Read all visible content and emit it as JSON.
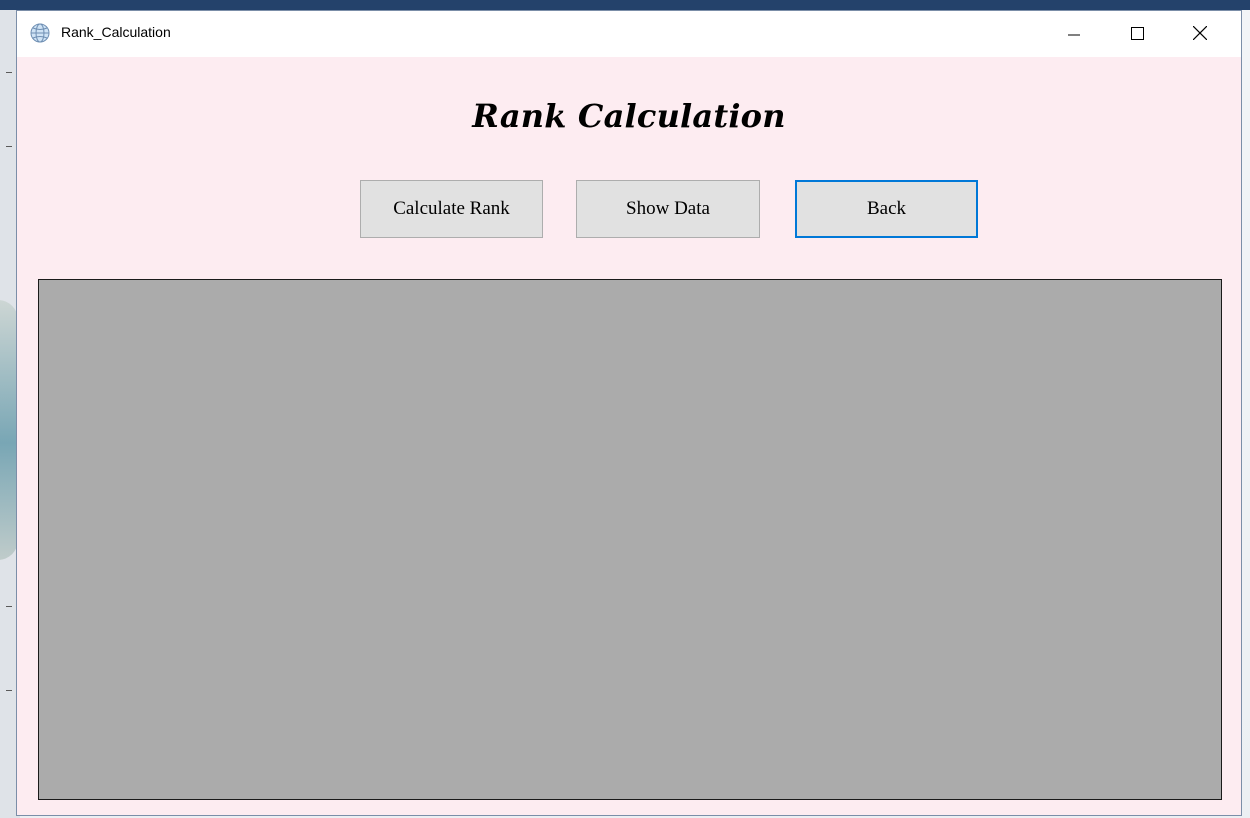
{
  "window": {
    "title": "Rank_Calculation",
    "app_icon": "globe-icon",
    "controls": {
      "minimize_icon": "minimize-icon",
      "maximize_icon": "maximize-icon",
      "close_icon": "close-icon"
    }
  },
  "main": {
    "heading": "Rank Calculation",
    "buttons": {
      "calculate_rank": "Calculate Rank",
      "show_data": "Show Data",
      "back": "Back"
    },
    "data_panel": {
      "background": "#ababab"
    }
  },
  "colors": {
    "window_background": "#fdecf1",
    "button_background": "#e1e1e1",
    "focus_accent": "#0078d7"
  }
}
